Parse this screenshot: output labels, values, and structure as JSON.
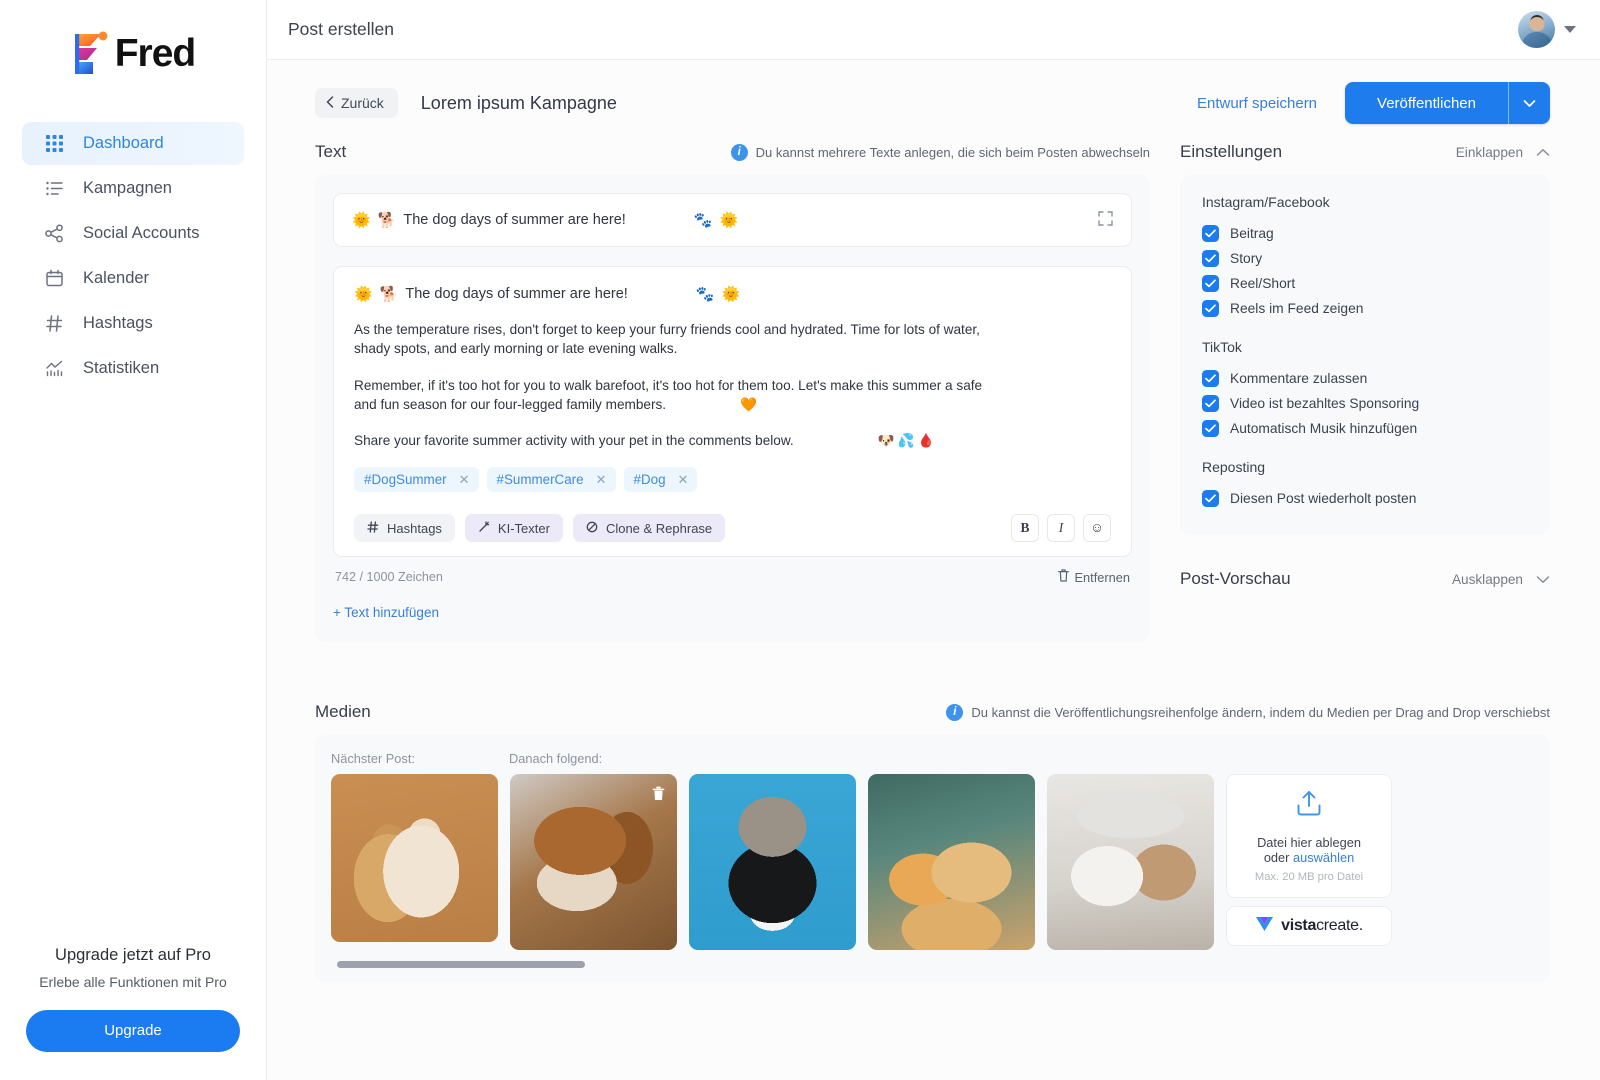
{
  "brand": {
    "name": "Fred"
  },
  "sidebar": {
    "items": [
      {
        "label": "Dashboard",
        "icon": "grid-icon",
        "active": true
      },
      {
        "label": "Kampagnen",
        "icon": "list-icon",
        "active": false
      },
      {
        "label": "Social Accounts",
        "icon": "share-icon",
        "active": false
      },
      {
        "label": "Kalender",
        "icon": "calendar-icon",
        "active": false
      },
      {
        "label": "Hashtags",
        "icon": "hash-icon",
        "active": false
      },
      {
        "label": "Statistiken",
        "icon": "chart-icon",
        "active": false
      }
    ],
    "upgrade": {
      "title": "Upgrade jetzt auf Pro",
      "subtitle": "Erlebe alle Funktionen mit Pro",
      "button": "Upgrade"
    }
  },
  "topbar": {
    "title": "Post erstellen",
    "avatar_icon": "user-avatar",
    "caret_icon": "chevron-down-icon"
  },
  "subheader": {
    "back_label": "Zurück",
    "back_icon": "chevron-left-icon",
    "campaign_title": "Lorem ipsum Kampagne",
    "save_draft": "Entwurf speichern",
    "publish": "Veröffentlichen",
    "publish_caret_icon": "chevron-down-icon"
  },
  "text_section": {
    "title": "Text",
    "hint": "Du kannst mehrere Texte anlegen, die sich beim Posten abwechseln",
    "hint_icon": "info-icon",
    "collapsed_card": {
      "lead_emoji_1": "🌞",
      "lead_emoji_2": "🐕",
      "headline": "The dog days of summer are here!",
      "trail_emoji_1": "🐾",
      "trail_emoji_2": "🌞",
      "expand_icon": "expand-icon"
    },
    "editor": {
      "lead_emoji_1": "🌞",
      "lead_emoji_2": "🐕",
      "headline": "The dog days of summer are here!",
      "trail_emoji_1": "🐾",
      "trail_emoji_2": "🌞",
      "paragraph_1": "As the temperature rises, don't forget to keep your furry friends cool and hydrated. Time for lots of water, shady spots, and early morning or late evening walks.",
      "paragraph_2": "Remember, if it's too hot for you to walk barefoot, it's too hot for them too. Let's make this summer a safe and fun season for our four-legged family members.",
      "paragraph_2_emoji": "🧡",
      "paragraph_3": "Share your favorite summer activity with your pet in the comments below.",
      "paragraph_3_emojis": "🐶💦🩸",
      "hashtags": [
        {
          "label": "#DogSummer",
          "remove_icon": "close-icon"
        },
        {
          "label": "#SummerCare",
          "remove_icon": "close-icon"
        },
        {
          "label": "#Dog",
          "remove_icon": "close-icon"
        }
      ],
      "tools": [
        {
          "label": "Hashtags",
          "icon": "hash-icon"
        },
        {
          "label": "KI-Texter",
          "icon": "magic-wand-icon"
        },
        {
          "label": "Clone & Rephrase",
          "icon": "clone-icon"
        }
      ],
      "format_buttons": [
        {
          "label": "B",
          "icon": "bold-icon"
        },
        {
          "label": "I",
          "icon": "italic-icon"
        },
        {
          "label": "☺",
          "icon": "emoji-icon"
        }
      ],
      "char_count": "742 / 1000 Zeichen",
      "remove_label": "Entfernen",
      "remove_icon": "trash-icon"
    },
    "add_text": "+ Text hinzufügen"
  },
  "settings": {
    "title": "Einstellungen",
    "toggle_label": "Einklappen",
    "toggle_icon": "chevron-up-icon",
    "groups": [
      {
        "label": "Instagram/Facebook",
        "options": [
          {
            "label": "Beitrag",
            "checked": true
          },
          {
            "label": "Story",
            "checked": true
          },
          {
            "label": "Reel/Short",
            "checked": true
          },
          {
            "label": "Reels im Feed zeigen",
            "checked": true
          }
        ]
      },
      {
        "label": "TikTok",
        "options": [
          {
            "label": "Kommentare zulassen",
            "checked": true
          },
          {
            "label": "Video ist bezahltes Sponsoring",
            "checked": true
          },
          {
            "label": "Automatisch Musik hinzufügen",
            "checked": true
          }
        ]
      },
      {
        "label": "Reposting",
        "options": [
          {
            "label": "Diesen Post wiederholt posten",
            "checked": true
          }
        ]
      }
    ]
  },
  "preview": {
    "title": "Post-Vorschau",
    "toggle_label": "Ausklappen",
    "toggle_icon": "chevron-down-icon"
  },
  "media": {
    "title": "Medien",
    "hint": "Du kannst die Veröffentlichungsreihenfolge ändern, indem du Medien per Drag and Drop verschiebst",
    "hint_icon": "info-icon",
    "label_next": "Nächster Post:",
    "label_following": "Danach folgend:",
    "thumbnails": [
      {
        "alt": "puppy and kitten on orange background",
        "art": "p1",
        "has_trash": false
      },
      {
        "alt": "brown dog hugging puppy",
        "art": "p2",
        "has_trash": true,
        "trash_icon": "trash-icon"
      },
      {
        "alt": "cat peeking behind black and white border collie",
        "art": "p3",
        "has_trash": false
      },
      {
        "alt": "orange cat and golden dog sleeping",
        "art": "p4",
        "has_trash": false
      },
      {
        "alt": "white dog and tabby cat under blanket",
        "art": "p5",
        "has_trash": false
      }
    ],
    "dropzone": {
      "icon": "upload-icon",
      "line1": "Datei hier ablegen",
      "line2_prefix": "oder",
      "line2_link": "auswählen",
      "max_note": "Max. 20 MB pro Datei"
    },
    "vista": {
      "icon": "vista-logo-icon",
      "text_bold": "vista",
      "text_rest": "create."
    },
    "scrollbar_icon": "horizontal-scrollbar"
  },
  "colors": {
    "accent_blue": "#1a7cf0",
    "link_blue": "#3680d8",
    "tag_blue": "#3e8ddd",
    "sidebar_active_bg": "#e8f2fd",
    "panel_bg": "#f8f9fb"
  }
}
